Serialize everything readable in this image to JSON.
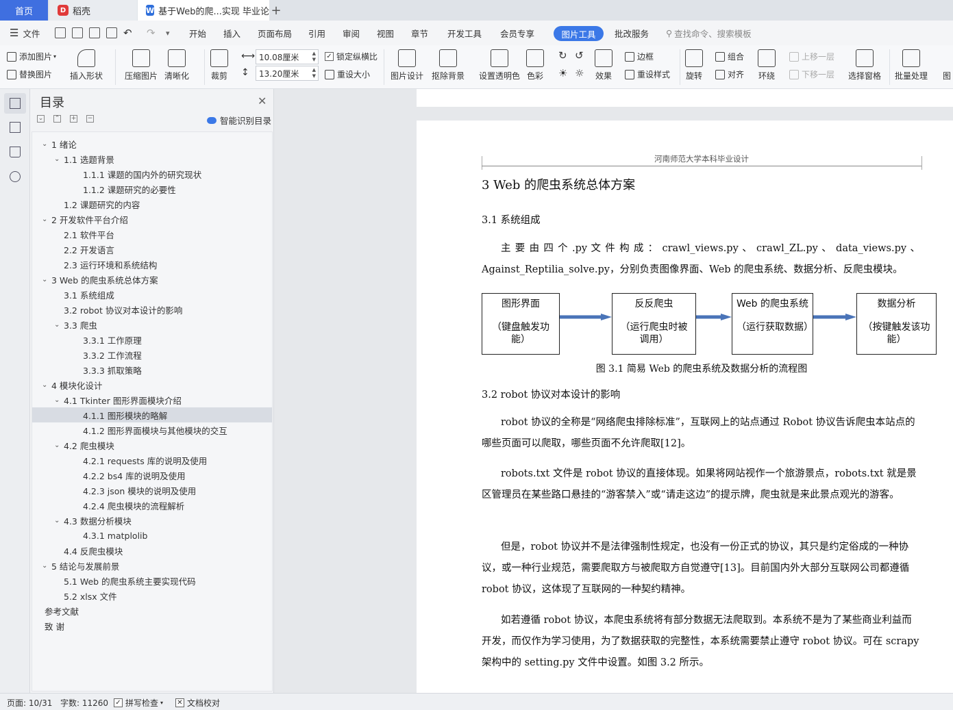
{
  "tabs": {
    "home": "首页",
    "dao": "稻壳",
    "doc": "基于Web的爬...实现 毕业论文"
  },
  "menu": {
    "file": "文件",
    "items": [
      "开始",
      "插入",
      "页面布局",
      "引用",
      "审阅",
      "视图",
      "章节",
      "开发工具",
      "会员专享"
    ],
    "active": "图片工具",
    "review": "批改服务",
    "search": "查找命令、搜索模板"
  },
  "ribbon": {
    "add_pic": "添加图片",
    "replace_pic": "替换图片",
    "insert_shape": "插入形状",
    "compress": "压缩图片",
    "clarify": "清晰化",
    "crop": "裁剪",
    "width": "10.08厘米",
    "height": "13.20厘米",
    "lock_ratio": "锁定纵横比",
    "reset_size": "重设大小",
    "pic_design": "图片设计",
    "remove_bg": "抠除背景",
    "set_trans": "设置透明色",
    "color": "色彩",
    "effect": "效果",
    "border": "边框",
    "reset_style": "重设样式",
    "rotate": "旋转",
    "group": "组合",
    "align": "对齐",
    "wrap": "环绕",
    "up": "上移一层",
    "down": "下移一层",
    "select_pane": "选择窗格",
    "batch": "批量处理",
    "more": "图"
  },
  "toc": {
    "title": "目录",
    "smart": "智能识别目录",
    "items": [
      {
        "t": "1  绪论",
        "lv": 1,
        "c": true
      },
      {
        "t": "1.1   选题背景",
        "lv": 2,
        "c": true
      },
      {
        "t": "1.1.1   课题的国内外的研究现状",
        "lv": 3
      },
      {
        "t": "1.1.2   课题研究的必要性",
        "lv": 3
      },
      {
        "t": "1.2   课题研究的内容",
        "lv": 2
      },
      {
        "t": "2  开发软件平台介绍",
        "lv": 1,
        "c": true
      },
      {
        "t": "2.1   软件平台",
        "lv": 2
      },
      {
        "t": "2.2   开发语言",
        "lv": 2
      },
      {
        "t": "2.3   运行环境和系统结构",
        "lv": 2
      },
      {
        "t": "3  Web 的爬虫系统总体方案",
        "lv": 1,
        "c": true
      },
      {
        "t": "3.1   系统组成",
        "lv": 2
      },
      {
        "t": "3.2   robot 协议对本设计的影响",
        "lv": 2
      },
      {
        "t": "3.3   爬虫",
        "lv": 2,
        "c": true
      },
      {
        "t": "3.3.1   工作原理",
        "lv": 3
      },
      {
        "t": "3.3.2   工作流程",
        "lv": 3
      },
      {
        "t": "3.3.3   抓取策略",
        "lv": 3
      },
      {
        "t": "4  模块化设计",
        "lv": 1,
        "c": true
      },
      {
        "t": "4.1  Tkinter 图形界面模块介绍",
        "lv": 2,
        "c": true
      },
      {
        "t": "4.1.1   图形模块的略解",
        "lv": 3,
        "sel": true
      },
      {
        "t": "4.1.2   图形界面模块与其他模块的交互",
        "lv": 3
      },
      {
        "t": "4.2   爬虫模块",
        "lv": 2,
        "c": true
      },
      {
        "t": "4.2.1   requests 库的说明及使用",
        "lv": 3
      },
      {
        "t": "4.2.2   bs4 库的说明及使用",
        "lv": 3
      },
      {
        "t": "4.2.3   json 模块的说明及使用",
        "lv": 3
      },
      {
        "t": "4.2.4   爬虫模块的流程解析",
        "lv": 3
      },
      {
        "t": "4.3 数据分析模块",
        "lv": 2,
        "c": true
      },
      {
        "t": "4.3.1   matplolib",
        "lv": 3
      },
      {
        "t": "4.4   反爬虫模块",
        "lv": 2
      },
      {
        "t": "5  结论与发展前景",
        "lv": 1,
        "c": true
      },
      {
        "t": "5.1   Web 的爬虫系统主要实现代码",
        "lv": 2
      },
      {
        "t": "5.2   xlsx 文件",
        "lv": 2
      },
      {
        "t": "参考文献",
        "lv": 0
      },
      {
        "t": "致    谢",
        "lv": 0
      }
    ]
  },
  "doc": {
    "header": "河南师范大学本科毕业设计",
    "h3": "3  Web 的爬虫系统总体方案",
    "h31": "3.1   系统组成",
    "p1": "主 要 由 四 个 .py 文 件 构 成 ： crawl_views.py 、 crawl_ZL.py 、 data_views.py 、Against_Reptilia_solve.py，分别负责图像界面、Web 的爬虫系统、数据分析、反爬虫模块。",
    "boxes": [
      {
        "title": "图形界面",
        "desc": "（键盘触发功能）"
      },
      {
        "title": "反反爬虫",
        "desc": "（运行爬虫时被调用）"
      },
      {
        "title": "Web 的爬虫系统",
        "desc": "（运行获取数据）"
      },
      {
        "title": "数据分析",
        "desc": "（按键触发该功能）"
      }
    ],
    "caption": "图 3.1 简易 Web 的爬虫系统及数据分析的流程图",
    "h32": "3.2   robot 协议对本设计的影响",
    "p2": "robot 协议的全称是“网络爬虫排除标准”，互联网上的站点通过 Robot 协议告诉爬虫本站点的哪些页面可以爬取，哪些页面不允许爬取[12]。",
    "p3": "robots.txt 文件是 robot 协议的直接体现。如果将网站视作一个旅游景点，robots.txt 就是景区管理员在某些路口悬挂的“游客禁入”或“请走这边”的提示牌，爬虫就是来此景点观光的游客。",
    "p4": "但是，robot 协议并不是法律强制性规定，也没有一份正式的协议，其只是约定俗成的一种协议，或一种行业规范，需要爬取方与被爬取方自觉遵守[13]。目前国内外大部分互联网公司都遵循 robot 协议，这体现了互联网的一种契约精神。",
    "p5": "如若遵循 robot 协议，本爬虫系统将有部分数据无法爬取到。本系统不是为了某些商业利益而开发，而仅作为学习使用，为了数据获取的完整性，本系统需要禁止遵守 robot 协议。可在 scrapy 架构中的 setting.py 文件中设置。如图 3.2 所示。"
  },
  "status": {
    "page": "页面: 10/31",
    "words": "字数: 11260",
    "spell": "拼写检查",
    "proof": "文档校对"
  },
  "colors": {
    "accent": "#3b78e7",
    "home_tab": "#3f6fe0",
    "arrow": "#4a74b8"
  }
}
